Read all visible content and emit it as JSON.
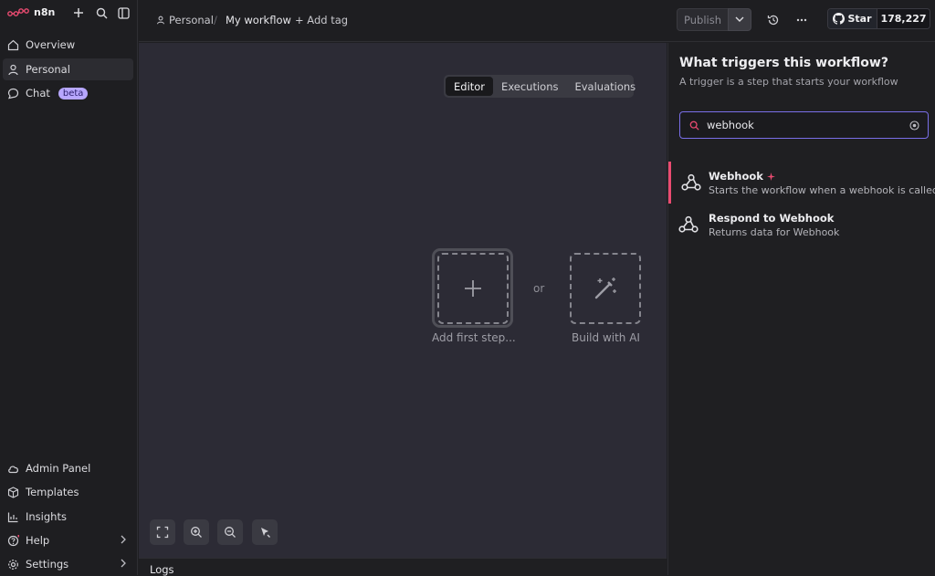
{
  "app": {
    "logo_text": "n8n",
    "accent": "#ea4b71",
    "focus_color": "#7a6fe8"
  },
  "sidebar": {
    "items": [
      {
        "label": "Overview",
        "icon": "home-icon"
      },
      {
        "label": "Personal",
        "icon": "user-icon",
        "active": true
      },
      {
        "label": "Chat",
        "icon": "chat-icon",
        "badge": "beta"
      }
    ],
    "bottom_items": [
      {
        "label": "Admin Panel",
        "icon": "cloud-icon"
      },
      {
        "label": "Templates",
        "icon": "package-icon"
      },
      {
        "label": "Insights",
        "icon": "chart-icon"
      },
      {
        "label": "Help",
        "icon": "help-icon"
      },
      {
        "label": "Settings",
        "icon": "gear-icon"
      }
    ]
  },
  "topbar": {
    "project": "Personal",
    "separator": "/",
    "workflow_name": "My workflow",
    "add_tag": "+ Add tag",
    "publish_label": "Publish",
    "github": {
      "star_label": "Star",
      "star_count": "178,227"
    }
  },
  "canvas": {
    "tabs": [
      {
        "label": "Editor",
        "active": true
      },
      {
        "label": "Executions"
      },
      {
        "label": "Evaluations"
      }
    ],
    "add_first_step": "Add first step...",
    "or_text": "or",
    "build_with_ai": "Build with AI"
  },
  "logs": {
    "label": "Logs"
  },
  "trigger_panel": {
    "title": "What triggers this workflow?",
    "subtitle": "A trigger is a step that starts your workflow",
    "search_value": "webhook",
    "results": [
      {
        "name": "Webhook",
        "description": "Starts the workflow when a webhook is called",
        "icon": "webhook-icon",
        "selected": true,
        "sparkle": true
      },
      {
        "name": "Respond to Webhook",
        "description": "Returns data for Webhook",
        "icon": "webhook-icon"
      }
    ]
  }
}
